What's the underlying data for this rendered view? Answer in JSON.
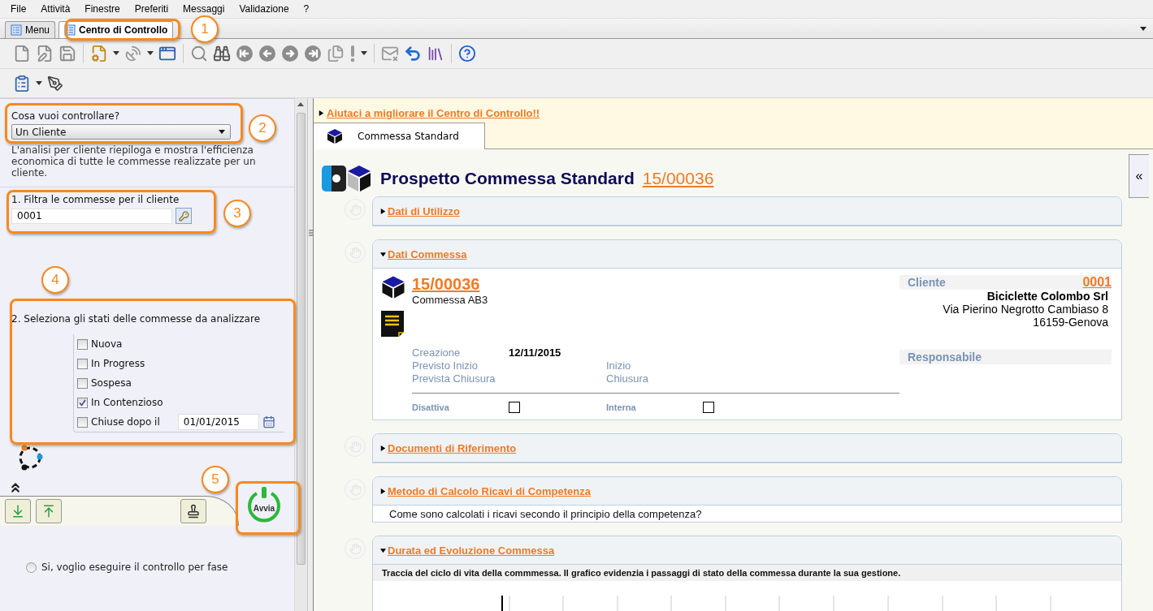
{
  "menu": [
    "File",
    "Attività",
    "Finestre",
    "Preferiti",
    "Messaggi",
    "Validazione",
    "?"
  ],
  "tabs": [
    {
      "label": "Menu",
      "selected": false
    },
    {
      "label": "Centro di Controllo",
      "selected": true
    }
  ],
  "left_panel": {
    "question": {
      "label": "Cosa vuoi controllare?",
      "value": "Un Cliente"
    },
    "description": "L'analisi per cliente riepiloga e mostra l'efficienza economica di tutte le commesse realizzate per un cliente.",
    "filter": {
      "label": "1. Filtra le commesse per il cliente",
      "value": "0001"
    },
    "states": {
      "title": "2. Seleziona gli stati delle commesse da analizzare",
      "options": [
        {
          "label": "Nuova",
          "checked": false
        },
        {
          "label": "In Progress",
          "checked": false
        },
        {
          "label": "Sospesa",
          "checked": false
        },
        {
          "label": "In Contenzioso",
          "checked": true
        },
        {
          "label": "Chiuse dopo il",
          "checked": false,
          "date": "01/01/2015"
        }
      ]
    },
    "start_button": "Avvia",
    "phase_option": {
      "label": "Si, voglio eseguire il controllo per fase",
      "selected": false
    }
  },
  "callouts": [
    "1",
    "2",
    "3",
    "4",
    "5"
  ],
  "right_panel": {
    "banner_link": "Aiutaci a migliorare il Centro di Controllo!!",
    "tab": {
      "label": "Commessa Standard",
      "selected": true
    },
    "collapse": "«",
    "title": "Prospetto Commessa Standard",
    "code": "15/00036",
    "sections": [
      {
        "kind": "plain",
        "title": "Dati di Utilizzo",
        "expanded": false
      },
      {
        "kind": "details",
        "title": "Dati Commessa",
        "expanded": true,
        "code": "15/00036",
        "name": "Commessa AB3",
        "dates": [
          {
            "cells": [
              {
                "label": "Creazione",
                "value": "12/11/2015"
              }
            ]
          },
          {
            "cells": [
              {
                "label": "Previsto Inizio"
              },
              {
                "label": "Inizio"
              }
            ]
          },
          {
            "cells": [
              {
                "label": "Prevista Chiusura"
              },
              {
                "label": "Chiusura"
              }
            ]
          }
        ],
        "flags": [
          {
            "label": "Disattiva",
            "checked": false
          },
          {
            "label": "Interna",
            "checked": false
          }
        ],
        "client": {
          "label": "Cliente",
          "code": "0001",
          "name": "Biciclette Colombo Srl",
          "address": [
            "Via Pierino Negrotto Cambiaso 8",
            "16159-Genova"
          ]
        },
        "manager": {
          "label": "Responsabile"
        }
      },
      {
        "kind": "plain",
        "title": "Documenti di Riferimento",
        "expanded": false
      },
      {
        "kind": "note",
        "title": "Metodo di Calcolo Ricavi di Competenza",
        "expanded": false,
        "note": "Come sono calcolati i ricavi secondo il principio della competenza?"
      },
      {
        "kind": "timeline",
        "title": "Durata ed Evoluzione Commessa",
        "expanded": true,
        "note": "Traccia del ciclo di vita della commmessa. Il grafico evidenzia i passaggi di stato della commessa durante la sua gestione."
      }
    ]
  }
}
